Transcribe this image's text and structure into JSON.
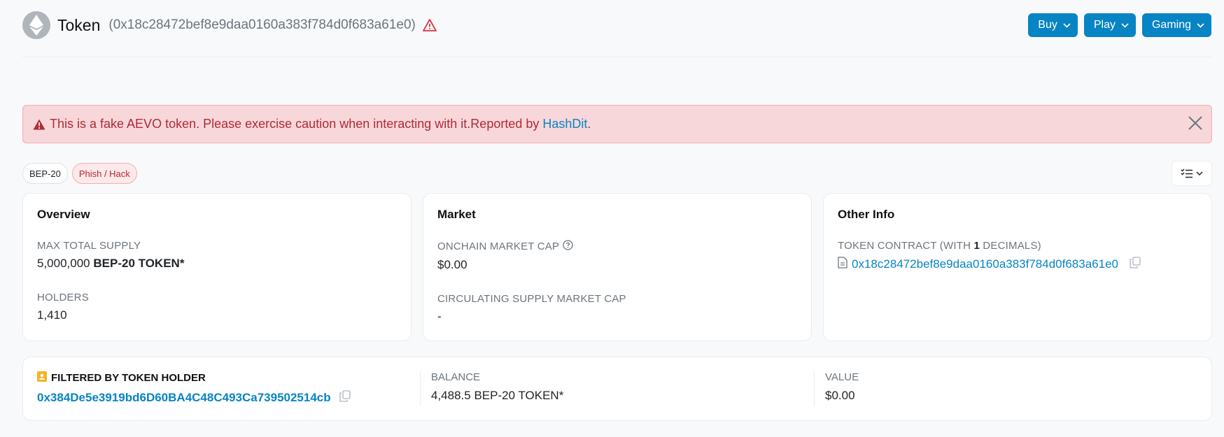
{
  "header": {
    "logo_icon": "ethereum-logo-icon",
    "title": "Token",
    "address": "(0x18c28472bef8e9daa0160a383f784d0f683a61e0)",
    "warning_icon": "warning-triangle-icon",
    "buttons": [
      {
        "label": "Buy"
      },
      {
        "label": "Play"
      },
      {
        "label": "Gaming"
      }
    ]
  },
  "alert": {
    "text": "This is a fake AEVO token. Please exercise caution when interacting with it.Reported by ",
    "link": "HashDit",
    "suffix": ".",
    "color": "#b02a37"
  },
  "badges": [
    {
      "label": "BEP-20"
    },
    {
      "label": "Phish / Hack"
    }
  ],
  "overview": {
    "title": "Overview",
    "max_supply_label": "MAX TOTAL SUPPLY",
    "max_supply_value": "5,000,000",
    "max_supply_unit": "BEP-20 TOKEN*",
    "holders_label": "HOLDERS",
    "holders_value": "1,410"
  },
  "market": {
    "title": "Market",
    "onchain_cap_label": "ONCHAIN MARKET CAP",
    "onchain_cap_value": "$0.00",
    "circ_cap_label": "CIRCULATING SUPPLY MARKET CAP",
    "circ_cap_value": "-"
  },
  "other_info": {
    "title": "Other Info",
    "contract_label_prefix": "TOKEN CONTRACT (WITH ",
    "contract_decimals": "1",
    "contract_label_suffix": " DECIMALS)",
    "contract_address": "0x18c28472bef8e9daa0160a383f784d0f683a61e0"
  },
  "holder_filter": {
    "label": "FILTERED BY TOKEN HOLDER",
    "address": "0x384De5e3919bd6D60BA4C48C493Ca739502514cb",
    "balance_label": "BALANCE",
    "balance_value": "4,488.5 BEP-20 TOKEN*",
    "value_label": "VALUE",
    "value_value": "$0.00"
  },
  "colors": {
    "accent": "#0784c3",
    "danger_bg": "#f8d7da",
    "holder_icon": "#f5b225"
  }
}
